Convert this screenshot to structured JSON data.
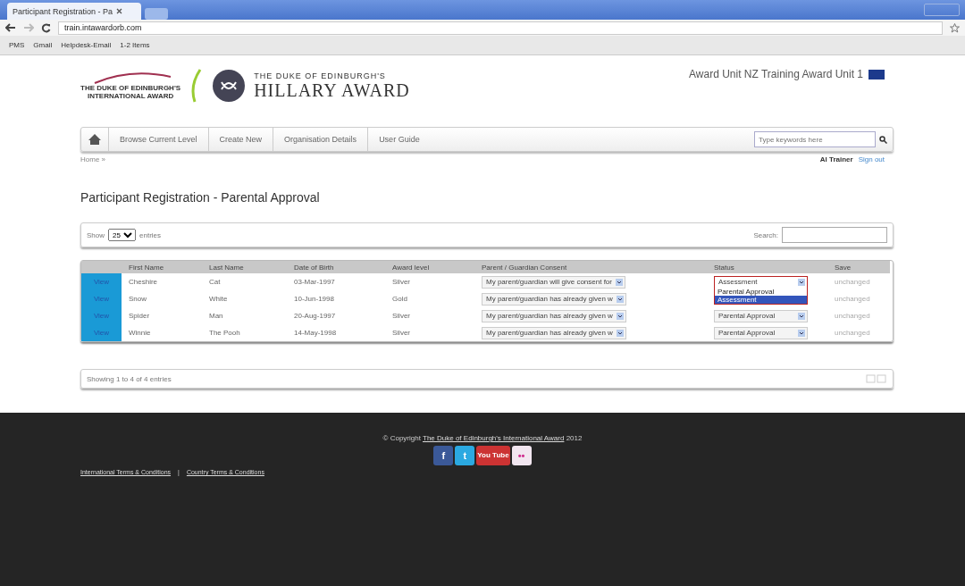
{
  "browser": {
    "tab_title": "Participant Registration - Pa",
    "url_domain": "train.intawardorb.com",
    "bookmarks": [
      "PMS",
      "Gmail",
      "Helpdesk-Email",
      "1-2 Items"
    ]
  },
  "header": {
    "logo_left": [
      "THE DUKE OF EDINBURGH'S",
      "INTERNATIONAL AWARD"
    ],
    "logo_right_small": "THE DUKE OF EDINBURGH'S",
    "logo_right_big": "HILLARY AWARD",
    "unit": "Award Unit NZ Training Award Unit 1"
  },
  "nav": {
    "items": [
      "Browse Current Level",
      "Create New",
      "Organisation Details",
      "User Guide"
    ],
    "search_placeholder": "Type keywords here"
  },
  "breadcrumb": "Home »",
  "user": {
    "name": "Al Trainer",
    "sign_out": "Sign out"
  },
  "page_title": "Participant Registration - Parental Approval",
  "table_controls": {
    "show": "Show",
    "page_size": "25",
    "entries": "entries",
    "search_label": "Search:"
  },
  "table": {
    "columns": [
      "First Name",
      "Last Name",
      "Date of Birth",
      "Award level",
      "Parent / Guardian Consent",
      "Status",
      "Save"
    ],
    "rows": [
      {
        "action": "View",
        "first_name": "Cheshire",
        "last_name": "Cat",
        "dob": "03-Mar-1997",
        "award": "Silver",
        "consent": "My parent/guardian will give consent for",
        "status": "Assessment",
        "save": "unchanged",
        "status_open": true,
        "status_options": [
          {
            "label": "Parental Approval",
            "selected": false
          },
          {
            "label": "Assessment",
            "selected": true
          }
        ]
      },
      {
        "action": "View",
        "first_name": "Snow",
        "last_name": "White",
        "dob": "10-Jun-1998",
        "award": "Gold",
        "consent": "My parent/guardian has already given w",
        "save": "unchanged"
      },
      {
        "action": "View",
        "first_name": "Spider",
        "last_name": "Man",
        "dob": "20-Aug-1997",
        "award": "Silver",
        "consent": "My parent/guardian has already given w",
        "status": "Parental Approval",
        "save": "unchanged",
        "status_open": false
      },
      {
        "action": "View",
        "first_name": "Winnie",
        "last_name": "The Pooh",
        "dob": "14-May-1998",
        "award": "Silver",
        "consent": "My parent/guardian has already given w",
        "status": "Parental Approval",
        "save": "unchanged",
        "status_open": false
      }
    ]
  },
  "table_info": "Showing 1 to 4 of 4 entries",
  "footer": {
    "copyright_prefix": "© Copyright",
    "copyright_link": "The Duke of Edinburgh's International Award",
    "copyright_year": "2012",
    "social": [
      {
        "kind": "facebook",
        "label": "f"
      },
      {
        "kind": "twitter",
        "label": "t"
      },
      {
        "kind": "youtube",
        "label": "You Tube"
      },
      {
        "kind": "flickr",
        "label": "••"
      }
    ],
    "links": [
      "International Terms & Conditions",
      "Country Terms & Conditions"
    ],
    "separator": "|"
  }
}
